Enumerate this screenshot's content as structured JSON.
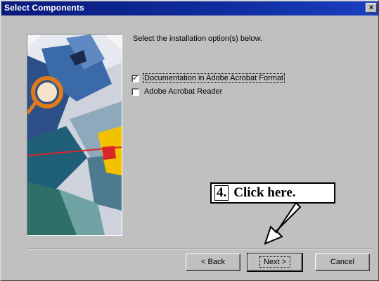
{
  "window": {
    "title": "Select Components",
    "close_glyph": "×"
  },
  "main": {
    "prompt": "Select the installation option(s) below.",
    "options": [
      {
        "label": "Documentation in Adobe Acrobat Format",
        "checked": true,
        "check_glyph": "✓"
      },
      {
        "label": "Adobe Acrobat Reader",
        "checked": false,
        "check_glyph": ""
      }
    ]
  },
  "buttons": {
    "back": "< Back",
    "next": "Next >",
    "cancel": "Cancel"
  },
  "callout": {
    "step": "4.",
    "text": "Click here."
  },
  "icons": {
    "callout_arrow": "arrow-icon"
  }
}
